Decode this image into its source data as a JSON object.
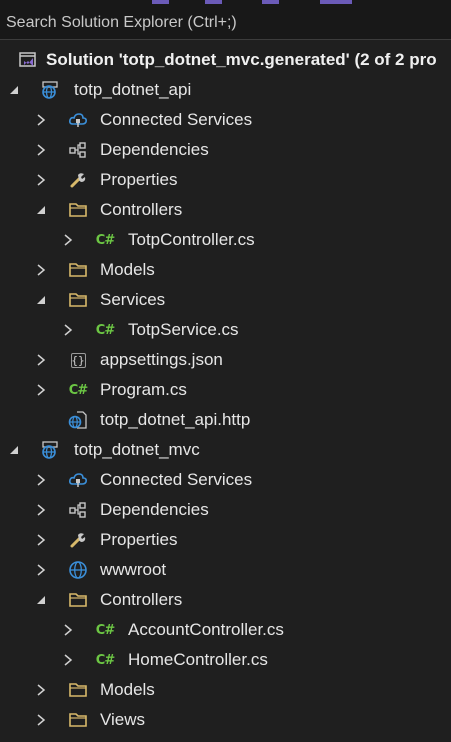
{
  "search": {
    "placeholder": "Search Solution Explorer (Ctrl+;)"
  },
  "tree": [
    {
      "label": "Solution 'totp_dotnet_mvc.generated' (2 of 2 pro",
      "icon": "solution-icon",
      "level": 0,
      "expander": "none",
      "kind": "solution"
    },
    {
      "label": "totp_dotnet_api",
      "icon": "web-project-icon",
      "level": 0,
      "expander": "expanded",
      "kind": "project"
    },
    {
      "label": "Connected Services",
      "icon": "connected-services-icon",
      "level": 1,
      "expander": "collapsed",
      "kind": "node"
    },
    {
      "label": "Dependencies",
      "icon": "dependencies-icon",
      "level": 1,
      "expander": "collapsed",
      "kind": "node"
    },
    {
      "label": "Properties",
      "icon": "wrench-icon",
      "level": 1,
      "expander": "collapsed",
      "kind": "node"
    },
    {
      "label": "Controllers",
      "icon": "folder-icon",
      "level": 1,
      "expander": "expanded",
      "kind": "folder"
    },
    {
      "label": "TotpController.cs",
      "icon": "csharp-file-icon",
      "level": 2,
      "expander": "collapsed",
      "kind": "file"
    },
    {
      "label": "Models",
      "icon": "folder-icon",
      "level": 1,
      "expander": "collapsed",
      "kind": "folder"
    },
    {
      "label": "Services",
      "icon": "folder-icon",
      "level": 1,
      "expander": "expanded",
      "kind": "folder"
    },
    {
      "label": "TotpService.cs",
      "icon": "csharp-file-icon",
      "level": 2,
      "expander": "collapsed",
      "kind": "file"
    },
    {
      "label": "appsettings.json",
      "icon": "json-file-icon",
      "level": 1,
      "expander": "collapsed",
      "kind": "file"
    },
    {
      "label": "Program.cs",
      "icon": "csharp-file-icon",
      "level": 1,
      "expander": "collapsed",
      "kind": "file"
    },
    {
      "label": "totp_dotnet_api.http",
      "icon": "http-file-icon",
      "level": 1,
      "expander": "none",
      "kind": "file"
    },
    {
      "label": "totp_dotnet_mvc",
      "icon": "web-project-icon",
      "level": 0,
      "expander": "expanded",
      "kind": "project"
    },
    {
      "label": "Connected Services",
      "icon": "connected-services-icon",
      "level": 1,
      "expander": "collapsed",
      "kind": "node"
    },
    {
      "label": "Dependencies",
      "icon": "dependencies-icon",
      "level": 1,
      "expander": "collapsed",
      "kind": "node"
    },
    {
      "label": "Properties",
      "icon": "wrench-icon",
      "level": 1,
      "expander": "collapsed",
      "kind": "node"
    },
    {
      "label": "wwwroot",
      "icon": "globe-icon",
      "level": 1,
      "expander": "collapsed",
      "kind": "node"
    },
    {
      "label": "Controllers",
      "icon": "folder-icon",
      "level": 1,
      "expander": "expanded",
      "kind": "folder"
    },
    {
      "label": "AccountController.cs",
      "icon": "csharp-file-icon",
      "level": 2,
      "expander": "collapsed",
      "kind": "file"
    },
    {
      "label": "HomeController.cs",
      "icon": "csharp-file-icon",
      "level": 2,
      "expander": "collapsed",
      "kind": "file"
    },
    {
      "label": "Models",
      "icon": "folder-icon",
      "level": 1,
      "expander": "collapsed",
      "kind": "folder"
    },
    {
      "label": "Views",
      "icon": "folder-icon",
      "level": 1,
      "expander": "collapsed",
      "kind": "folder"
    }
  ],
  "colors": {
    "background": "#1f1f1f",
    "text": "#e6e6e6",
    "folder": "#d8b96a",
    "csharp": "#6cc644",
    "blue": "#3b8fd9",
    "solution_accent": "#8a6bd1"
  }
}
